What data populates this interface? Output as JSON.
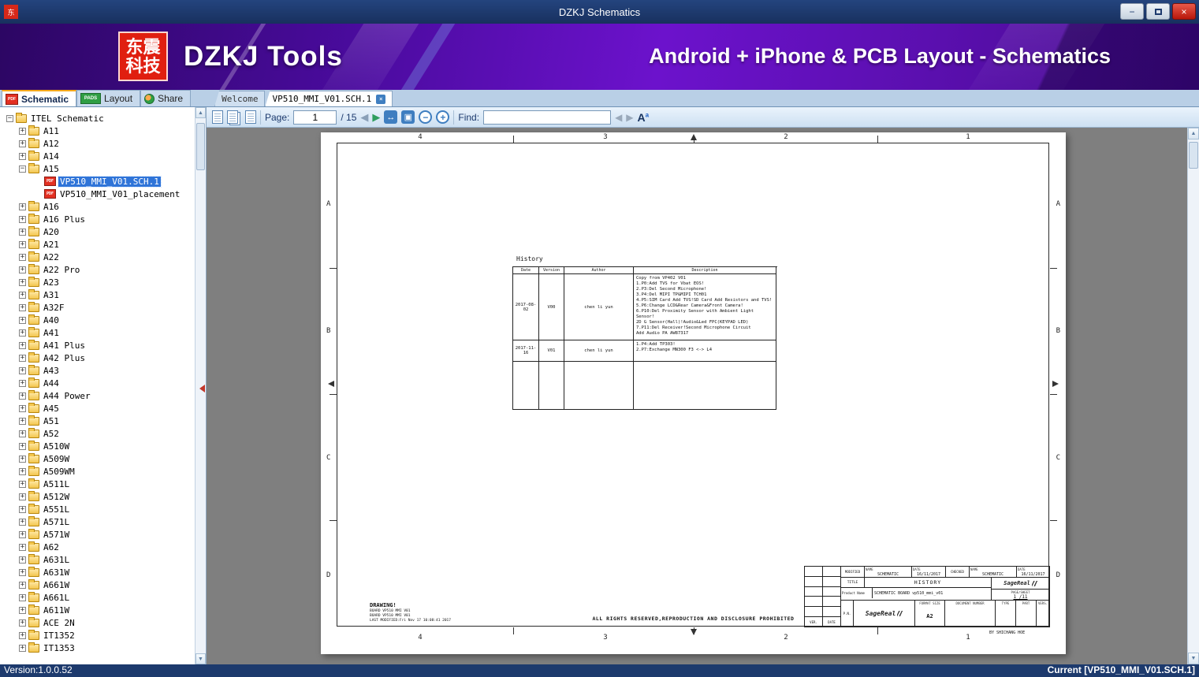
{
  "window": {
    "title": "DZKJ Schematics"
  },
  "icons": {
    "minimize": "−",
    "close": "×",
    "prev_page": "◀",
    "next_page": "▶",
    "fit_width": "↔",
    "fit_page": "▣",
    "zoom_out": "−",
    "zoom_in": "+",
    "find_prev": "◀",
    "find_next": "▶",
    "font_a": "A",
    "font_a_sup": "a",
    "scroll_up": "▲",
    "scroll_down": "▼",
    "pdf_badge": "PDF",
    "pads_badge": "PADS",
    "app_glyph": "东"
  },
  "banner": {
    "logo_line1": "东震",
    "logo_line2": "科技",
    "app_name": "DZKJ Tools",
    "tagline": "Android + iPhone & PCB Layout - Schematics"
  },
  "tabs": {
    "schematic": "Schematic",
    "layout": "Layout",
    "share": "Share",
    "welcome": "Welcome",
    "document": "VP510_MMI_V01.SCH.1"
  },
  "toolbar": {
    "page_label": "Page:",
    "page_value": "1",
    "page_total": "/ 15",
    "find_label": "Find:",
    "find_value": ""
  },
  "sidebar": {
    "tree": [
      {
        "label": "ITEL Schematic",
        "type": "folder",
        "level": 0,
        "expander": "minus"
      },
      {
        "label": "A11",
        "type": "folder",
        "level": 1,
        "expander": "plus"
      },
      {
        "label": "A12",
        "type": "folder",
        "level": 1,
        "expander": "plus"
      },
      {
        "label": "A14",
        "type": "folder",
        "level": 1,
        "expander": "plus"
      },
      {
        "label": "A15",
        "type": "folder",
        "level": 1,
        "expander": "minus"
      },
      {
        "label": "VP510_MMI_V01.SCH.1",
        "type": "pdf",
        "level": 2,
        "selected": true
      },
      {
        "label": "VP510_MMI_V01_placement",
        "type": "pdf",
        "level": 2
      },
      {
        "label": "A16",
        "type": "folder",
        "level": 1,
        "expander": "plus"
      },
      {
        "label": "A16 Plus",
        "type": "folder",
        "level": 1,
        "expander": "plus"
      },
      {
        "label": "A20",
        "type": "folder",
        "level": 1,
        "expander": "plus"
      },
      {
        "label": "A21",
        "type": "folder",
        "level": 1,
        "expander": "plus"
      },
      {
        "label": "A22",
        "type": "folder",
        "level": 1,
        "expander": "plus"
      },
      {
        "label": "A22 Pro",
        "type": "folder",
        "level": 1,
        "expander": "plus"
      },
      {
        "label": "A23",
        "type": "folder",
        "level": 1,
        "expander": "plus"
      },
      {
        "label": "A31",
        "type": "folder",
        "level": 1,
        "expander": "plus"
      },
      {
        "label": "A32F",
        "type": "folder",
        "level": 1,
        "expander": "plus"
      },
      {
        "label": "A40",
        "type": "folder",
        "level": 1,
        "expander": "plus"
      },
      {
        "label": "A41",
        "type": "folder",
        "level": 1,
        "expander": "plus"
      },
      {
        "label": "A41 Plus",
        "type": "folder",
        "level": 1,
        "expander": "plus"
      },
      {
        "label": "A42 Plus",
        "type": "folder",
        "level": 1,
        "expander": "plus"
      },
      {
        "label": "A43",
        "type": "folder",
        "level": 1,
        "expander": "plus"
      },
      {
        "label": "A44",
        "type": "folder",
        "level": 1,
        "expander": "plus"
      },
      {
        "label": "A44 Power",
        "type": "folder",
        "level": 1,
        "expander": "plus"
      },
      {
        "label": "A45",
        "type": "folder",
        "level": 1,
        "expander": "plus"
      },
      {
        "label": "A51",
        "type": "folder",
        "level": 1,
        "expander": "plus"
      },
      {
        "label": "A52",
        "type": "folder",
        "level": 1,
        "expander": "plus"
      },
      {
        "label": "A510W",
        "type": "folder",
        "level": 1,
        "expander": "plus"
      },
      {
        "label": "A509W",
        "type": "folder",
        "level": 1,
        "expander": "plus"
      },
      {
        "label": "A509WM",
        "type": "folder",
        "level": 1,
        "expander": "plus"
      },
      {
        "label": "A511L",
        "type": "folder",
        "level": 1,
        "expander": "plus"
      },
      {
        "label": "A512W",
        "type": "folder",
        "level": 1,
        "expander": "plus"
      },
      {
        "label": "A551L",
        "type": "folder",
        "level": 1,
        "expander": "plus"
      },
      {
        "label": "A571L",
        "type": "folder",
        "level": 1,
        "expander": "plus"
      },
      {
        "label": "A571W",
        "type": "folder",
        "level": 1,
        "expander": "plus"
      },
      {
        "label": "A62",
        "type": "folder",
        "level": 1,
        "expander": "plus"
      },
      {
        "label": "A631L",
        "type": "folder",
        "level": 1,
        "expander": "plus"
      },
      {
        "label": "A631W",
        "type": "folder",
        "level": 1,
        "expander": "plus"
      },
      {
        "label": "A661W",
        "type": "folder",
        "level": 1,
        "expander": "plus"
      },
      {
        "label": "A661L",
        "type": "folder",
        "level": 1,
        "expander": "plus"
      },
      {
        "label": "A611W",
        "type": "folder",
        "level": 1,
        "expander": "plus"
      },
      {
        "label": "ACE 2N",
        "type": "folder",
        "level": 1,
        "expander": "plus"
      },
      {
        "label": "IT1352",
        "type": "folder",
        "level": 1,
        "expander": "plus"
      },
      {
        "label": "IT1353",
        "type": "folder",
        "level": 1,
        "expander": "plus"
      }
    ]
  },
  "page": {
    "grid_top": [
      "4",
      "3",
      "2",
      "1"
    ],
    "grid_bottom": [
      "4",
      "3",
      "2",
      "1"
    ],
    "grid_left": [
      "A",
      "B",
      "C",
      "D"
    ],
    "grid_right": [
      "A",
      "B",
      "C",
      "D"
    ],
    "history": {
      "title": "History",
      "headers": [
        "Date",
        "Version",
        "Author",
        "Description"
      ],
      "rows": [
        {
          "date": "2017-08-02",
          "version": "V00",
          "author": "chen li yun",
          "description": "Copy from VP402 V01\n1.P0:Add TVS for Vbat EOS!\n2.P3:Del Second Microphone!\n3.P4:Del MIPI TP&MIPI TCH01\n4.P5:SIM Card Add TVS!SD Card Add Resistors and TVS!\n5.P6:Change LCD&Rear Camera&Front Camera!\n6.P10:Del Proximity Sensor with Ambient Light Sensor!\n   2D G Sensor(Hall)!Audio&Led FPC(KEYPAD LED)\n7.P11:Del Receiver!Second Microphone Circuit\n   Add Audio PA AW87317"
        },
        {
          "date": "2017-11-16",
          "version": "V01",
          "author": "chen li yun",
          "description": "1.P4:Add TP303!\n2.P7:Exchange MN300 F3 <-> L4"
        },
        {
          "date": "",
          "version": "",
          "author": "",
          "description": ""
        }
      ]
    },
    "titleblock": {
      "modified_label": "MODIFIED",
      "checked_label": "CHECKED",
      "name_label": "NAME",
      "date_label": "DATE",
      "name1": "SCHEMATIC",
      "date1": "16/11/2017",
      "name2": "SCHEMATIC",
      "date2": "16/11/2017",
      "title_label": "TITLE",
      "title_value": "HISTORY",
      "product_label": "Product Name",
      "product_value": "SCHEMATIC BOARD vp510_mmi_v01",
      "brand": "SageReal",
      "page_sheet_label": "PAGE/SHEET",
      "page_sheet_value": "1 /11",
      "pn_label": "P.N.",
      "format_label": "FORMAT SIZE",
      "format_value": "A2",
      "doc_number_label": "DOCUMENT NUMBER",
      "type_label": "TYPE",
      "part_label": "PART",
      "vers_label": "VERS.",
      "ver_col": "VER.",
      "date_col": "DATE",
      "by_line": "BY SHICHANG HOE"
    },
    "drawing_title": "DRAWING!",
    "drawing_note": "BOARD VP510 MMI V01\nBOARD VP510 MMI V01\nLAST MODIFIED:Fri Nov 17 10:08:41 2017",
    "rights_notice": "ALL RIGHTS RESERVED,REPRODUCTION AND DISCLOSURE PROHIBITED"
  },
  "statusbar": {
    "left": "Version:1.0.0.52",
    "right": "Current [VP510_MMI_V01.SCH.1]"
  }
}
